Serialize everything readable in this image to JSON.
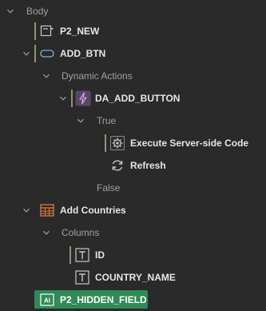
{
  "tree": {
    "body": "Body",
    "p2_new": "P2_NEW",
    "add_btn": "ADD_BTN",
    "dynamic_actions": "Dynamic Actions",
    "da_add_button": "DA_ADD_BUTTON",
    "true_branch": "True",
    "execute_server_side_code": "Execute Server-side Code",
    "refresh": "Refresh",
    "false_branch": "False",
    "add_countries": "Add Countries",
    "columns": "Columns",
    "col_id": "ID",
    "col_country_name": "COUNTRY_NAME",
    "p2_hidden_field": "P2_HIDDEN_FIELD"
  },
  "colors": {
    "background": "#2a2a2a",
    "selected": "#2f8a57",
    "accent_bar": "#8a9670"
  }
}
